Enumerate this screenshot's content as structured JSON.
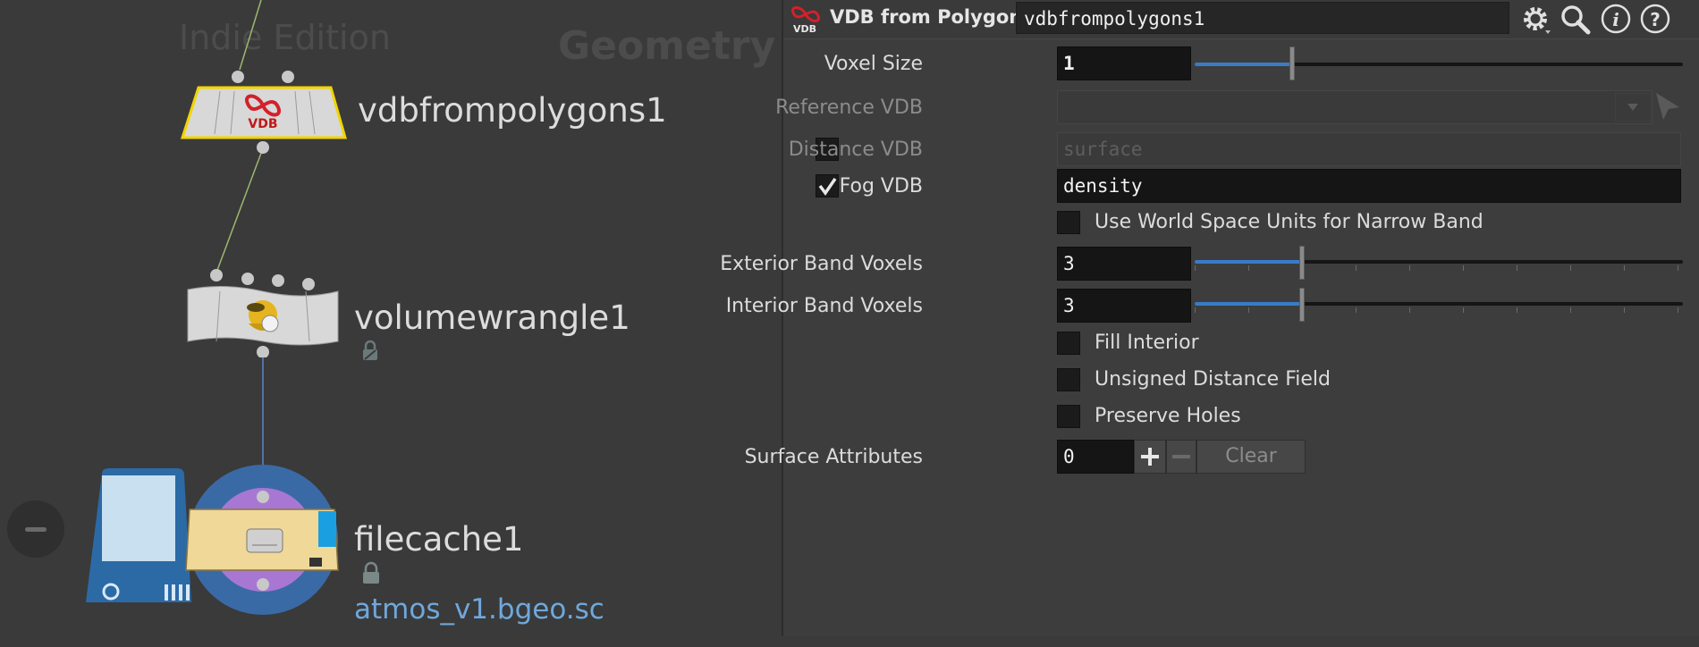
{
  "network": {
    "watermark_edition": "Indie Edition",
    "watermark_context": "Geometry",
    "nodes": [
      {
        "name": "vdbfrompolygons1",
        "icon": "vdb-icon"
      },
      {
        "name": "volumewrangle1",
        "icon": "wrangle-icon"
      },
      {
        "name": "filecache1",
        "icon": "filecache-icon",
        "file": "atmos_v1.bgeo.sc"
      }
    ]
  },
  "params": {
    "op_type": "VDB from Polygons",
    "op_name": "vdbfrompolygons1",
    "header_buttons": [
      "gear-icon",
      "search-icon",
      "info-icon",
      "help-icon"
    ],
    "voxel_size": {
      "label": "Voxel Size",
      "value": "1",
      "slider_fraction": 0.2
    },
    "reference_vdb": {
      "label": "Reference VDB",
      "value": ""
    },
    "distance_vdb": {
      "label": "Distance VDB",
      "value": "surface",
      "checked": false
    },
    "fog_vdb": {
      "label": "Fog VDB",
      "value": "density",
      "checked": true
    },
    "world_space": {
      "label": "Use World Space Units for Narrow Band",
      "checked": false
    },
    "exterior_band": {
      "label": "Exterior Band Voxels",
      "value": "3",
      "slider_fraction": 0.22
    },
    "interior_band": {
      "label": "Interior Band Voxels",
      "value": "3",
      "slider_fraction": 0.22
    },
    "fill_interior": {
      "label": "Fill Interior",
      "checked": false
    },
    "unsigned_distance": {
      "label": "Unsigned Distance Field",
      "checked": false
    },
    "preserve_holes": {
      "label": "Preserve Holes",
      "checked": false
    },
    "surface_attributes": {
      "label": "Surface Attributes",
      "value": "0",
      "clear_label": "Clear"
    }
  },
  "colors": {
    "selected_node_outline": "#f2d400",
    "slider_fill": "#3a7bc8",
    "file_link": "#6fa8dc"
  }
}
